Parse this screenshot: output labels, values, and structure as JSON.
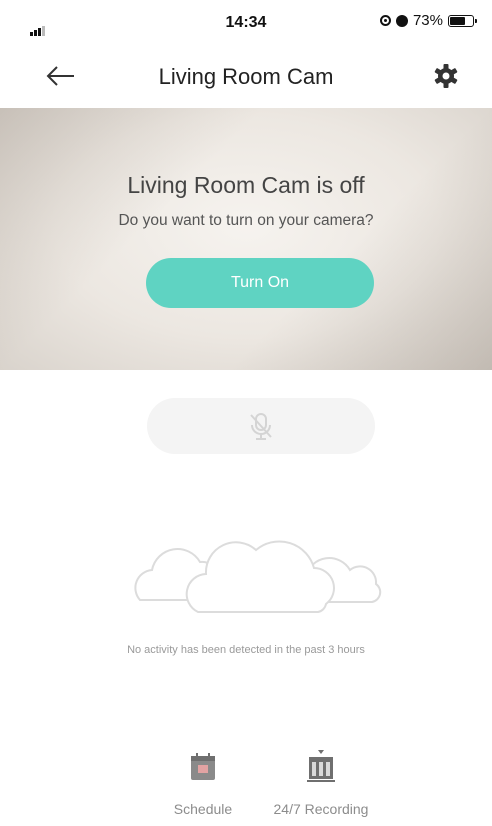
{
  "status_bar": {
    "time": "14:34",
    "battery_text": "73%",
    "battery_level": 0.73
  },
  "header": {
    "title": "Living Room Cam",
    "back_icon": "arrow-left-icon",
    "settings_icon": "gear-icon"
  },
  "preview": {
    "status_title": "Living Room Cam is off",
    "prompt": "Do you want to turn on your camera?",
    "turn_on_label": "Turn On"
  },
  "colors": {
    "accent": "#5fd3c2"
  },
  "activity": {
    "empty_message": "No activity has been detected in the past 3 hours"
  },
  "bottom": {
    "items": [
      {
        "label": "Schedule",
        "icon": "calendar-icon"
      },
      {
        "label": "24/7 Recording",
        "icon": "recording-icon"
      }
    ]
  }
}
